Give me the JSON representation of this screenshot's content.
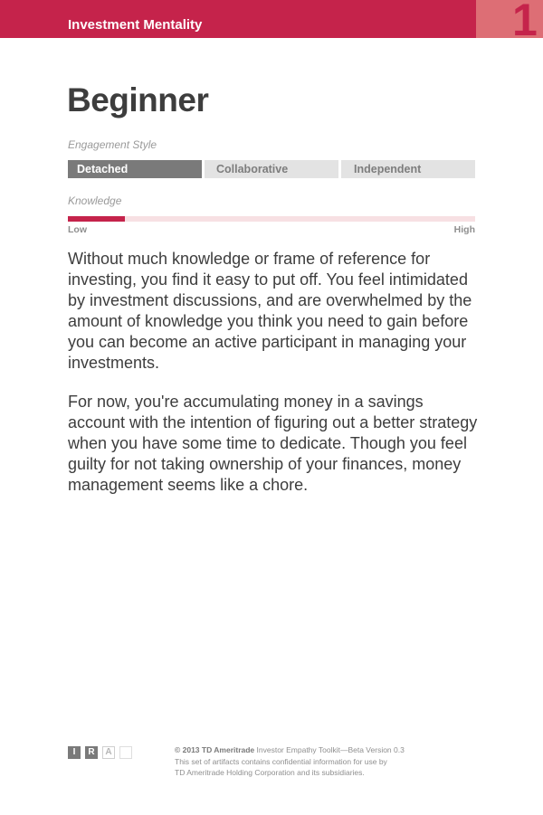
{
  "header": {
    "title": "Investment Mentality",
    "page_number": "1"
  },
  "persona": {
    "title": "Beginner"
  },
  "engagement": {
    "label": "Engagement Style",
    "options": [
      "Detached",
      "Collaborative",
      "Independent"
    ],
    "selected": "Detached"
  },
  "knowledge": {
    "label": "Knowledge",
    "low_label": "Low",
    "high_label": "High",
    "level_fraction": 0.14
  },
  "body": {
    "paragraphs": [
      "Without much knowledge or frame of reference for investing, you find it easy to put off. You feel intimidated by investment discussions, and are overwhelmed by the amount of knowledge you think you need to gain before you can become an active participant in managing your investments.",
      "For now, you're accumulating money in a savings account with the intention of figuring out a better strategy when you have some time to dedicate. Though you feel guilty for not taking ownership of your finances, money management seems like a chore."
    ]
  },
  "footer": {
    "marks": [
      "I",
      "R",
      "A",
      ""
    ],
    "copyright": "© 2013 TD Ameritrade",
    "toolkit": " Investor Empathy Toolkit—Beta Version 0.3",
    "line2": "This set of artifacts contains confidential information for use by",
    "line3": "TD Ameritrade Holding Corporation and its subsidiaries."
  },
  "colors": {
    "brand_red": "#c5234b",
    "brand_light_red": "#dd6e75",
    "selected_gray": "#7a7a7a",
    "unselected_gray": "#e3e3e3"
  }
}
